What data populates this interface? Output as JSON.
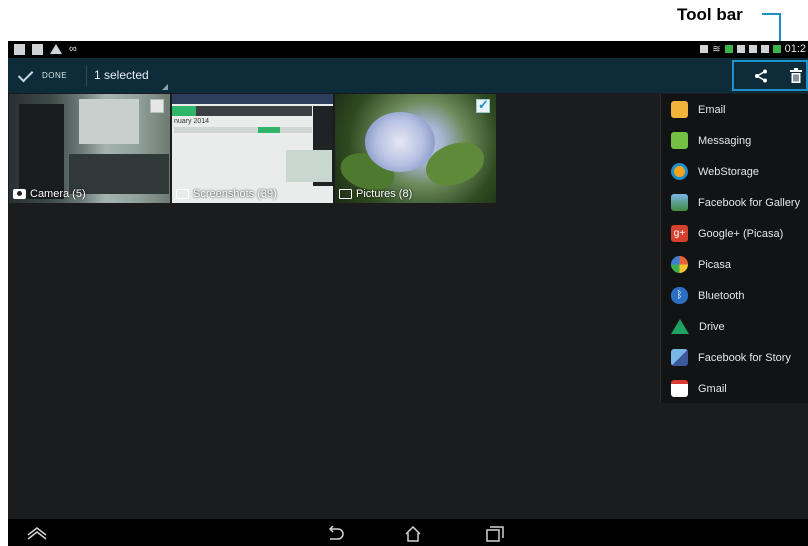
{
  "annotation": {
    "label": "Tool bar",
    "line_color": "#1e90c8"
  },
  "status_bar": {
    "time": "01:2"
  },
  "action_bar": {
    "done_label": "DONE",
    "selection_label": "1 selected"
  },
  "toolbar": {
    "share_icon": "share-icon",
    "delete_icon": "trash-icon"
  },
  "albums": [
    {
      "label": "Camera (5)",
      "icon": "camera-icon",
      "checked": false
    },
    {
      "label": "Screenshots (39)",
      "icon": "folder-icon",
      "checked": false
    },
    {
      "label": "Pictures (8)",
      "icon": "folder-icon",
      "checked": true
    }
  ],
  "screenshot_thumb": {
    "month": "nuary 2014"
  },
  "share_menu": {
    "items": [
      {
        "label": "Email",
        "icon": "email-icon",
        "color": "#f2b43a"
      },
      {
        "label": "Messaging",
        "icon": "messaging-icon",
        "color": "#74c043"
      },
      {
        "label": "WebStorage",
        "icon": "webstorage-icon",
        "color": "#f6a21a"
      },
      {
        "label": "Facebook for Gallery",
        "icon": "facebook-gallery-icon",
        "color": "#4a8cc7"
      },
      {
        "label": "Google+ (Picasa)",
        "icon": "google-plus-icon",
        "color": "#d6402e"
      },
      {
        "label": "Picasa",
        "icon": "picasa-icon",
        "color": "#e9633a"
      },
      {
        "label": "Bluetooth",
        "icon": "bluetooth-icon",
        "color": "#2a6fc2"
      },
      {
        "label": "Drive",
        "icon": "drive-icon",
        "color": "#1ea362"
      },
      {
        "label": "Facebook for Story",
        "icon": "facebook-story-icon",
        "color": "#3b5998"
      },
      {
        "label": "Gmail",
        "icon": "gmail-icon",
        "color": "#d93b30"
      }
    ]
  },
  "accent_color": "#1e90c8"
}
